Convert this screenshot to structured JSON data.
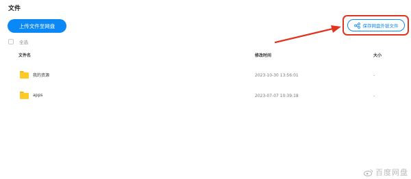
{
  "page": {
    "title": "文件"
  },
  "toolbar": {
    "upload_label": "上传文件至网盘",
    "select_all_label": "全选"
  },
  "table": {
    "columns": [
      "文件名",
      "修改时间",
      "大小"
    ],
    "rows": [
      {
        "name": "我的资源",
        "modified": "2023-10-30 13:56:01",
        "size": "-"
      },
      {
        "name": "apps",
        "modified": "2023-07-07 10:39:18",
        "size": "-"
      }
    ]
  },
  "save": {
    "label": "保存网盘外链文件",
    "icon": "share-link-icon"
  },
  "watermark": {
    "text": "百度网盘",
    "icon": "weibo-icon"
  },
  "colors": {
    "accent": "#0a88f5",
    "highlight": "#e0341d",
    "folder": "#ffca28"
  }
}
